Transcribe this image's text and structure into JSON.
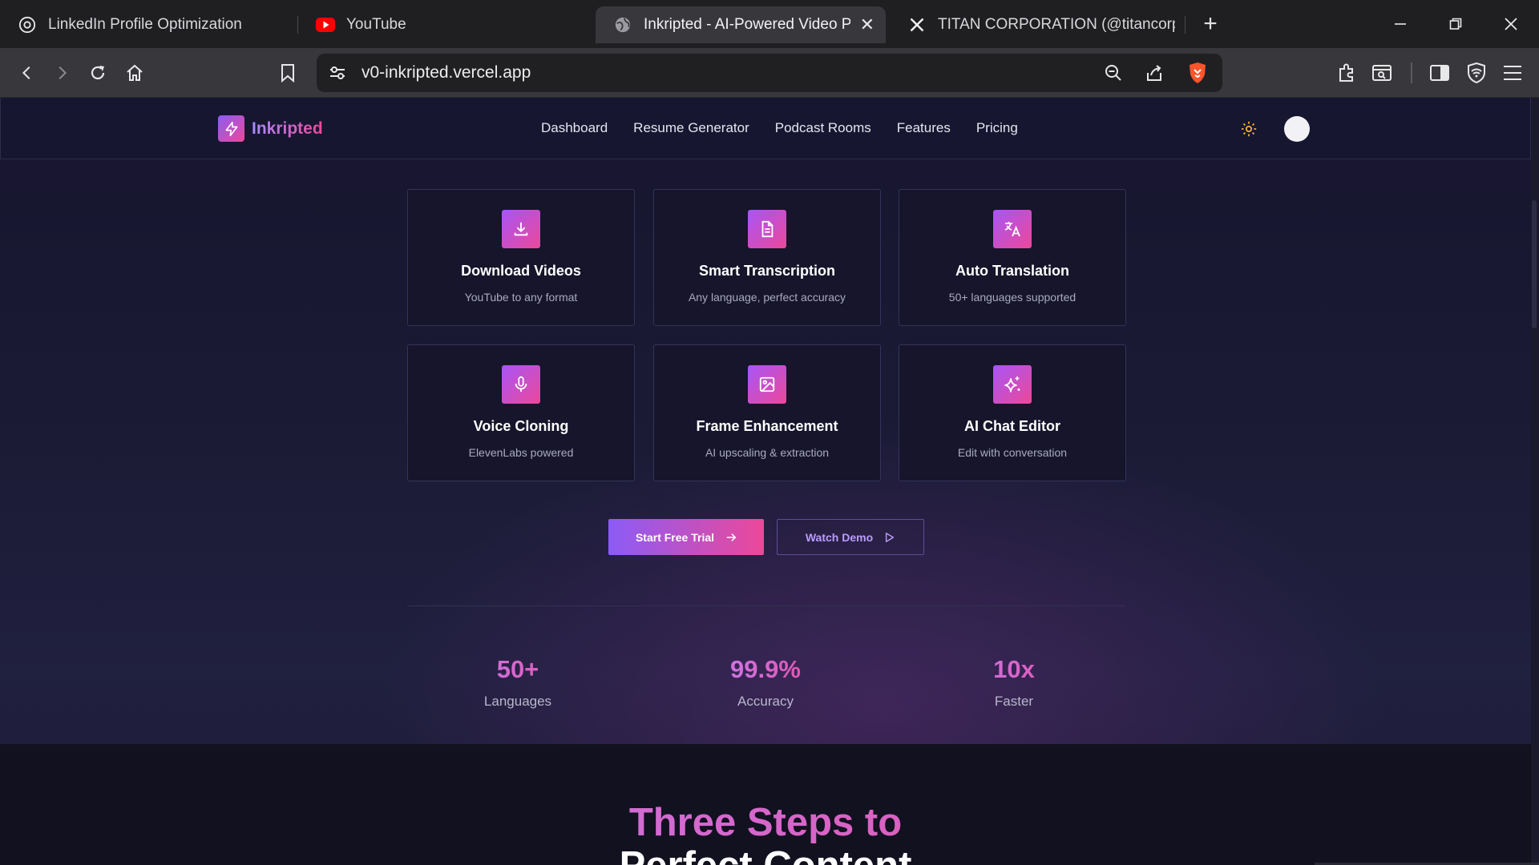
{
  "browser": {
    "tabs": [
      {
        "label": "LinkedIn Profile Optimization",
        "icon": "openai-icon"
      },
      {
        "label": "YouTube",
        "icon": "youtube-icon"
      },
      {
        "label": "Inkripted - AI-Powered Video Pro",
        "icon": "globe-icon",
        "active": true
      },
      {
        "label": "TITAN CORPORATION (@titancorpng",
        "icon": "x-icon"
      }
    ],
    "url": "v0-inkripted.vercel.app"
  },
  "site": {
    "brand": "Inkripted",
    "nav": [
      "Dashboard",
      "Resume Generator",
      "Podcast Rooms",
      "Features",
      "Pricing"
    ]
  },
  "features": [
    {
      "title": "Download Videos",
      "subtitle": "YouTube to any format",
      "icon": "download-icon"
    },
    {
      "title": "Smart Transcription",
      "subtitle": "Any language, perfect accuracy",
      "icon": "document-icon"
    },
    {
      "title": "Auto Translation",
      "subtitle": "50+ languages supported",
      "icon": "translate-icon"
    },
    {
      "title": "Voice Cloning",
      "subtitle": "ElevenLabs powered",
      "icon": "microphone-icon"
    },
    {
      "title": "Frame Enhancement",
      "subtitle": "AI upscaling & extraction",
      "icon": "image-icon"
    },
    {
      "title": "AI Chat Editor",
      "subtitle": "Edit with conversation",
      "icon": "sparkles-icon"
    }
  ],
  "cta": {
    "primary": "Start Free Trial",
    "secondary": "Watch Demo"
  },
  "stats": [
    {
      "value": "50+",
      "label": "Languages"
    },
    {
      "value": "99.9%",
      "label": "Accuracy"
    },
    {
      "value": "10x",
      "label": "Faster"
    }
  ],
  "steps": {
    "title_line1": "Three Steps to",
    "title_line2": "Perfect Content"
  },
  "colors": {
    "accent_start": "#8b5cf6",
    "accent_end": "#ec4899",
    "page_bg": "#1b1b36"
  }
}
